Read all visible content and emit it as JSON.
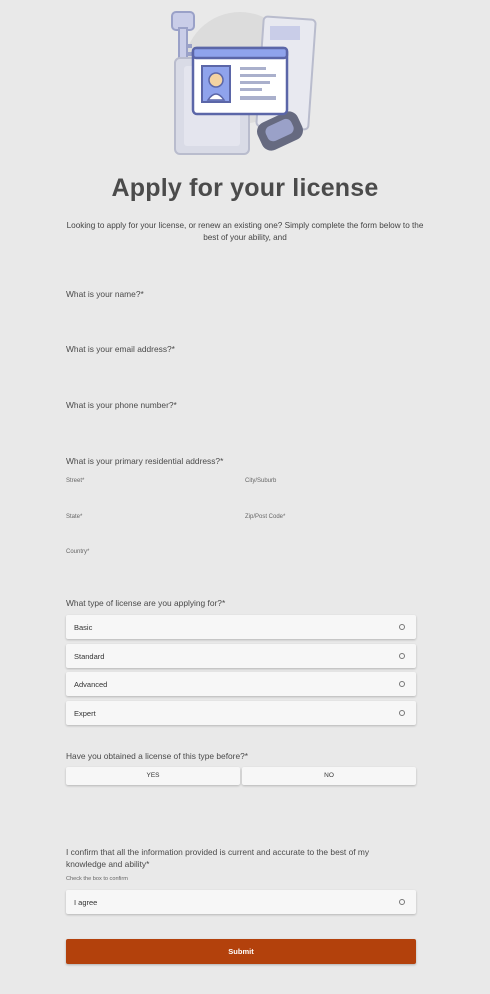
{
  "page": {
    "title": "Apply for your license",
    "intro": "Looking to apply for your license, or renew an existing one? Simply complete the form below to the best of your ability, and"
  },
  "questions": {
    "name": "What is your name?*",
    "email": "What is your email address?*",
    "phone": "What is your phone number?*",
    "address": "What is your primary residential address?*",
    "license_type": "What type of license are you applying for?*",
    "obtained_before": "Have you obtained a license of this type before?*"
  },
  "address_fields": {
    "street": "Street*",
    "city": "City/Suburb",
    "state": "State*",
    "zip": "Zip/Post Code*",
    "country": "Country*"
  },
  "license_options": [
    "Basic",
    "Standard",
    "Advanced",
    "Expert"
  ],
  "yes_no": {
    "yes": "YES",
    "no": "NO"
  },
  "confirm": {
    "text": "I confirm that all the information provided is current and accurate to the best of my knowledge and ability*",
    "hint": "Check the box to confirm",
    "agree": "I agree"
  },
  "submit_label": "Submit",
  "colors": {
    "background": "#e9e9e9",
    "submit": "#b3410c",
    "illustration_accent": "#7f8fd6"
  },
  "icons": {
    "hero": "license-id-card-illustration"
  }
}
